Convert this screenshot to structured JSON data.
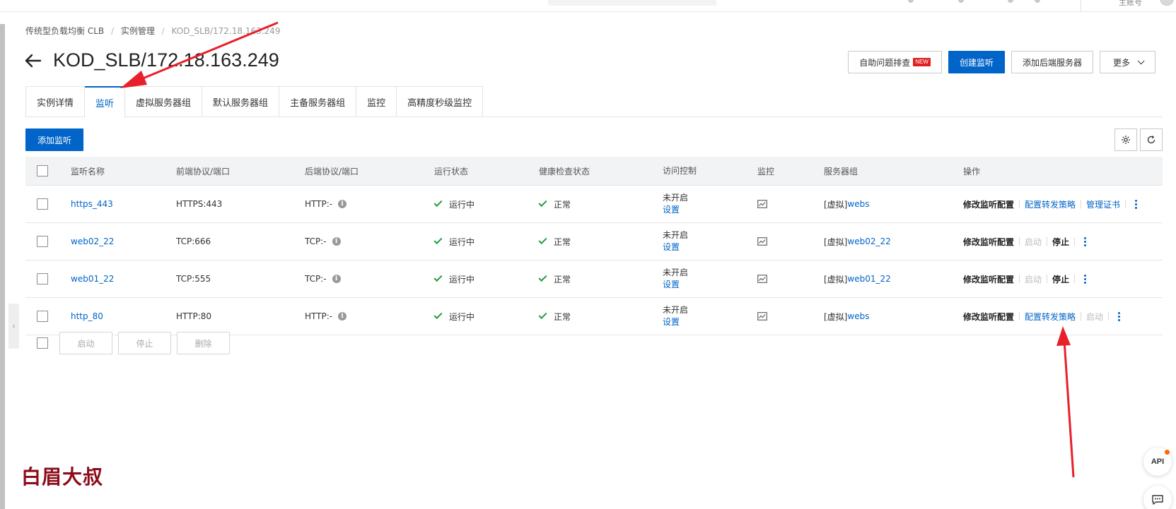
{
  "topbar": {
    "account_label": "主账号"
  },
  "breadcrumb": [
    "传统型负载均衡 CLB",
    "实例管理",
    "KOD_SLB/172.18.163.249"
  ],
  "page": {
    "title": "KOD_SLB/172.18.163.249"
  },
  "header_actions": {
    "self_check": "自助问题排查",
    "new_badge": "NEW",
    "create_listener": "创建监听",
    "add_backend": "添加后端服务器",
    "more": "更多"
  },
  "tabs": [
    {
      "label": "实例详情",
      "active": false
    },
    {
      "label": "监听",
      "active": true
    },
    {
      "label": "虚拟服务器组",
      "active": false
    },
    {
      "label": "默认服务器组",
      "active": false
    },
    {
      "label": "主备服务器组",
      "active": false
    },
    {
      "label": "监控",
      "active": false
    },
    {
      "label": "高精度秒级监控",
      "active": false
    }
  ],
  "toolbar": {
    "add_listener": "添加监听"
  },
  "table": {
    "headers": [
      "监听名称",
      "前端协议/端口",
      "后端协议/端口",
      "运行状态",
      "健康检查状态",
      "访问控制",
      "监控",
      "服务器组",
      "操作"
    ],
    "rows": [
      {
        "name": "https_443",
        "frontend": "HTTPS:443",
        "backend": "HTTP:-",
        "run_status": "运行中",
        "health": "正常",
        "acl_status": "未开启",
        "acl_link": "设置",
        "group_prefix": "[虚拟]",
        "group_name": "webs",
        "ops": [
          {
            "label": "修改监听配置",
            "style": "bold"
          },
          {
            "label": "配置转发策略",
            "style": "link"
          },
          {
            "label": "管理证书",
            "style": "link"
          }
        ]
      },
      {
        "name": "web02_22",
        "frontend": "TCP:666",
        "backend": "TCP:-",
        "run_status": "运行中",
        "health": "正常",
        "acl_status": "未开启",
        "acl_link": "设置",
        "group_prefix": "[虚拟]",
        "group_name": "web02_22",
        "ops": [
          {
            "label": "修改监听配置",
            "style": "bold"
          },
          {
            "label": "启动",
            "style": "dis"
          },
          {
            "label": "停止",
            "style": "bold"
          }
        ]
      },
      {
        "name": "web01_22",
        "frontend": "TCP:555",
        "backend": "TCP:-",
        "run_status": "运行中",
        "health": "正常",
        "acl_status": "未开启",
        "acl_link": "设置",
        "group_prefix": "[虚拟]",
        "group_name": "web01_22",
        "ops": [
          {
            "label": "修改监听配置",
            "style": "bold"
          },
          {
            "label": "启动",
            "style": "dis"
          },
          {
            "label": "停止",
            "style": "bold"
          }
        ]
      },
      {
        "name": "http_80",
        "frontend": "HTTP:80",
        "backend": "HTTP:-",
        "run_status": "运行中",
        "health": "正常",
        "acl_status": "未开启",
        "acl_link": "设置",
        "group_prefix": "[虚拟]",
        "group_name": "webs",
        "ops": [
          {
            "label": "修改监听配置",
            "style": "bold"
          },
          {
            "label": "配置转发策略",
            "style": "link"
          },
          {
            "label": "启动",
            "style": "dis"
          }
        ]
      }
    ]
  },
  "footer_actions": {
    "start": "启动",
    "stop": "停止",
    "delete": "删除"
  },
  "watermark": "白眉大叔",
  "float_buttons": {
    "api": "API"
  },
  "colors": {
    "primary": "#0064c8",
    "success": "#1e9e3a",
    "annotation": "#e8202a",
    "badge": "#e02020",
    "watermark": "#8b0d1a"
  }
}
